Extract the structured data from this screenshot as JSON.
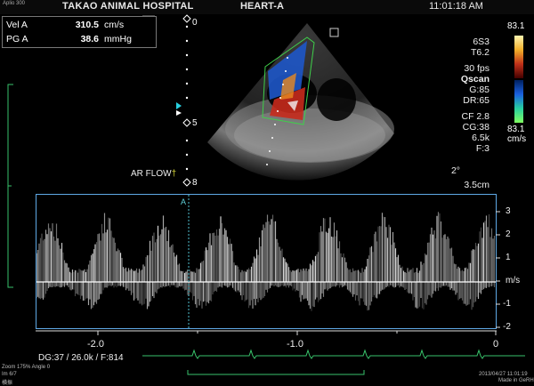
{
  "header": {
    "tiny_label": "Aplio 300",
    "hospital": "TAKAO ANIMAL HOSPITAL",
    "preset": "HEART-A",
    "time": "11:01:18 AM"
  },
  "measurements": [
    {
      "label": "Vel  A",
      "value": "310.5",
      "unit": "cm/s"
    },
    {
      "label": "PG  A",
      "value": "38.6",
      "unit": "mmHg"
    }
  ],
  "depth_scale": [
    "0",
    "5",
    "8"
  ],
  "annotation": "AR FLOW",
  "imaging_params": [
    "6S3",
    "T6.2",
    "30 fps",
    "Qscan",
    "G:85",
    "DR:65",
    "CF 2.8",
    "CG:38",
    "6.5k",
    "F:3"
  ],
  "angle": "2°",
  "depth": "3.5cm",
  "color_scale": {
    "top": "83.1",
    "bottom": "83.1",
    "unit": "cm/s"
  },
  "cursor_label": "A",
  "doppler": {
    "y_ticks": [
      "3",
      "2",
      "1",
      "m/s",
      "-1",
      "-2"
    ],
    "x_ticks": [
      "-2.0",
      "-1.0",
      "0"
    ]
  },
  "status_line": "DG:37  / 26.0k  / F:814",
  "footer_left": [
    "Zoom  175%  Angle  0",
    "Im  6/7",
    "横振"
  ],
  "footer_right": [
    "2013/04/27 11:01:19",
    "Made in GeRH"
  ],
  "colors": {
    "accent": "#5fa9e6",
    "ecg": "#38c26b"
  }
}
